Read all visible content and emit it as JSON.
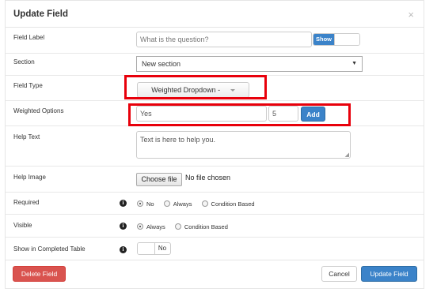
{
  "modal": {
    "title": "Update Field",
    "close_glyph": "×"
  },
  "fields": {
    "field_label": {
      "label": "Field Label",
      "placeholder": "What is the question?",
      "toggle_label": "Show"
    },
    "section": {
      "label": "Section",
      "selected": "New section"
    },
    "field_type": {
      "label": "Field Type",
      "selected": "Weighted Dropdown -"
    },
    "weighted_options": {
      "label": "Weighted Options",
      "option_value": "Yes",
      "weight_value": "5",
      "add_label": "Add"
    },
    "help_text": {
      "label": "Help Text",
      "value": "Text is here to help you."
    },
    "help_image": {
      "label": "Help Image",
      "choose_label": "Choose file",
      "status": "No file chosen"
    },
    "required": {
      "label": "Required",
      "options": [
        "No",
        "Always",
        "Condition Based"
      ],
      "selected": "No"
    },
    "visible": {
      "label": "Visible",
      "options": [
        "Always",
        "Condition Based"
      ],
      "selected": "Always"
    },
    "show_in_completed_table": {
      "label": "Show in Completed Table",
      "toggle_label": "No"
    }
  },
  "footer": {
    "delete_label": "Delete Field",
    "cancel_label": "Cancel",
    "update_label": "Update Field"
  },
  "icons": {
    "info": "info-icon",
    "caret": "chevron-down-icon",
    "close": "close-icon"
  },
  "colors": {
    "primary": "#3b83c9",
    "danger": "#d9534f",
    "highlight": "#e8000b"
  }
}
